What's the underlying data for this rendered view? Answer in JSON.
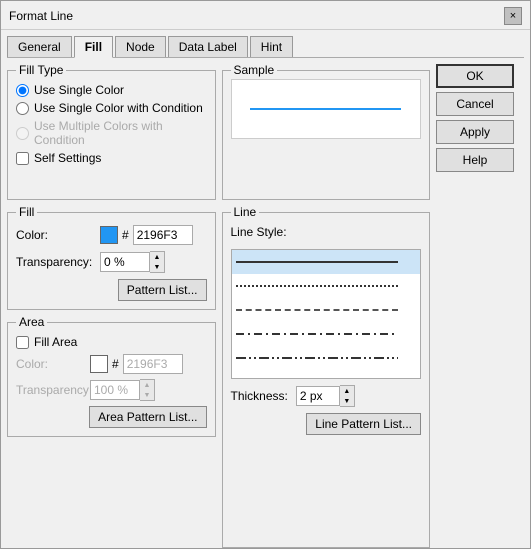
{
  "dialog": {
    "title": "Format Line",
    "close_btn": "×"
  },
  "tabs": [
    {
      "id": "general",
      "label": "General",
      "active": false
    },
    {
      "id": "fill",
      "label": "Fill",
      "active": true
    },
    {
      "id": "node",
      "label": "Node",
      "active": false
    },
    {
      "id": "data-label",
      "label": "Data Label",
      "active": false
    },
    {
      "id": "hint",
      "label": "Hint",
      "active": false
    }
  ],
  "fill_type": {
    "label": "Fill Type",
    "options": [
      {
        "id": "single",
        "label": "Use Single Color",
        "checked": true,
        "disabled": false
      },
      {
        "id": "single_condition",
        "label": "Use Single Color with Condition",
        "checked": false,
        "disabled": false
      },
      {
        "id": "multi_condition",
        "label": "Use Multiple Colors with Condition",
        "checked": false,
        "disabled": true
      }
    ],
    "self_settings": {
      "label": "Self Settings",
      "checked": false
    }
  },
  "sample": {
    "label": "Sample"
  },
  "fill": {
    "label": "Fill",
    "color_label": "Color:",
    "color_hex": "2196F3",
    "transparency_label": "Transparency:",
    "transparency_value": "0 %",
    "pattern_btn": "Pattern List..."
  },
  "area": {
    "label": "Area",
    "fill_area_label": "Fill Area",
    "fill_area_checked": false,
    "color_label": "Color:",
    "color_hex": "2196F3",
    "transparency_label": "Transparency:",
    "transparency_value": "100 %",
    "pattern_btn": "Area Pattern List..."
  },
  "line": {
    "label": "Line",
    "style_label": "Line Style:",
    "thickness_label": "Thickness:",
    "thickness_value": "2 px",
    "pattern_btn": "Line Pattern List...",
    "styles": [
      {
        "type": "solid",
        "selected": true
      },
      {
        "type": "dotted",
        "selected": false
      },
      {
        "type": "dashed-sm",
        "selected": false
      },
      {
        "type": "dash-dot",
        "selected": false
      },
      {
        "type": "dash-dot2",
        "selected": false
      }
    ]
  },
  "buttons": {
    "ok": "OK",
    "cancel": "Cancel",
    "apply": "Apply",
    "help": "Help"
  }
}
